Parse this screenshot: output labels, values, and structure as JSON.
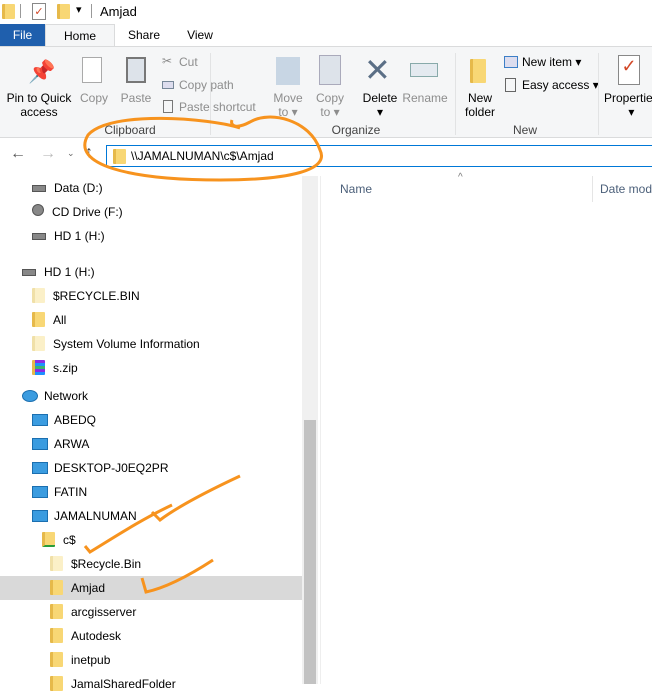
{
  "window": {
    "title": "Amjad"
  },
  "tabs": [
    {
      "label": "File"
    },
    {
      "label": "Home"
    },
    {
      "label": "Share"
    },
    {
      "label": "View"
    }
  ],
  "ribbon": {
    "pin": "Pin to Quick access",
    "pin1": "Pin to Quick",
    "pin2": "access",
    "copy": "Copy",
    "paste": "Paste",
    "cut": "Cut",
    "copy_path": "Copy path",
    "paste_shortcut": "Paste shortcut",
    "move1": "Move",
    "move2": "to",
    "copyto1": "Copy",
    "copyto2": "to",
    "delete": "Delete",
    "rename": "Rename",
    "newfolder1": "New",
    "newfolder2": "folder",
    "new_item": "New item",
    "easy_access": "Easy access",
    "properties": "Properties",
    "groups": {
      "clipboard": "Clipboard",
      "organize": "Organize",
      "new": "New"
    }
  },
  "address": {
    "path": "\\\\JAMALNUMAN\\c$\\Amjad"
  },
  "columns": {
    "name": "Name",
    "date": "Date mod"
  },
  "nav": {
    "items": [
      {
        "label": "Data (D:)",
        "icon": "drive-icon"
      },
      {
        "label": "CD Drive (F:)",
        "icon": "cd-drive-icon"
      },
      {
        "label": "HD 1 (H:)",
        "icon": "drive-icon"
      },
      {
        "label": "HD 1 (H:)",
        "icon": "drive-icon"
      },
      {
        "label": "$RECYCLE.BIN",
        "icon": "folder-icon"
      },
      {
        "label": "All",
        "icon": "folder-icon"
      },
      {
        "label": "System Volume Information",
        "icon": "folder-icon"
      },
      {
        "label": "s.zip",
        "icon": "zip-icon"
      },
      {
        "label": "Network",
        "icon": "network-icon"
      },
      {
        "label": "ABEDQ",
        "icon": "computer-icon"
      },
      {
        "label": "ARWA",
        "icon": "computer-icon"
      },
      {
        "label": "DESKTOP-J0EQ2PR",
        "icon": "computer-icon"
      },
      {
        "label": "FATIN",
        "icon": "computer-icon"
      },
      {
        "label": "JAMALNUMAN",
        "icon": "computer-icon"
      },
      {
        "label": "c$",
        "icon": "share-icon"
      },
      {
        "label": "$Recycle.Bin",
        "icon": "folder-icon"
      },
      {
        "label": "Amjad",
        "icon": "folder-icon",
        "selected": true
      },
      {
        "label": "arcgisserver",
        "icon": "folder-icon"
      },
      {
        "label": "Autodesk",
        "icon": "folder-icon"
      },
      {
        "label": "inetpub",
        "icon": "folder-icon"
      },
      {
        "label": "JamalSharedFolder",
        "icon": "folder-icon"
      }
    ]
  },
  "colors": {
    "accent": "#0078d7",
    "annotation": "#f7931e",
    "selected": "#d9d9d9"
  }
}
